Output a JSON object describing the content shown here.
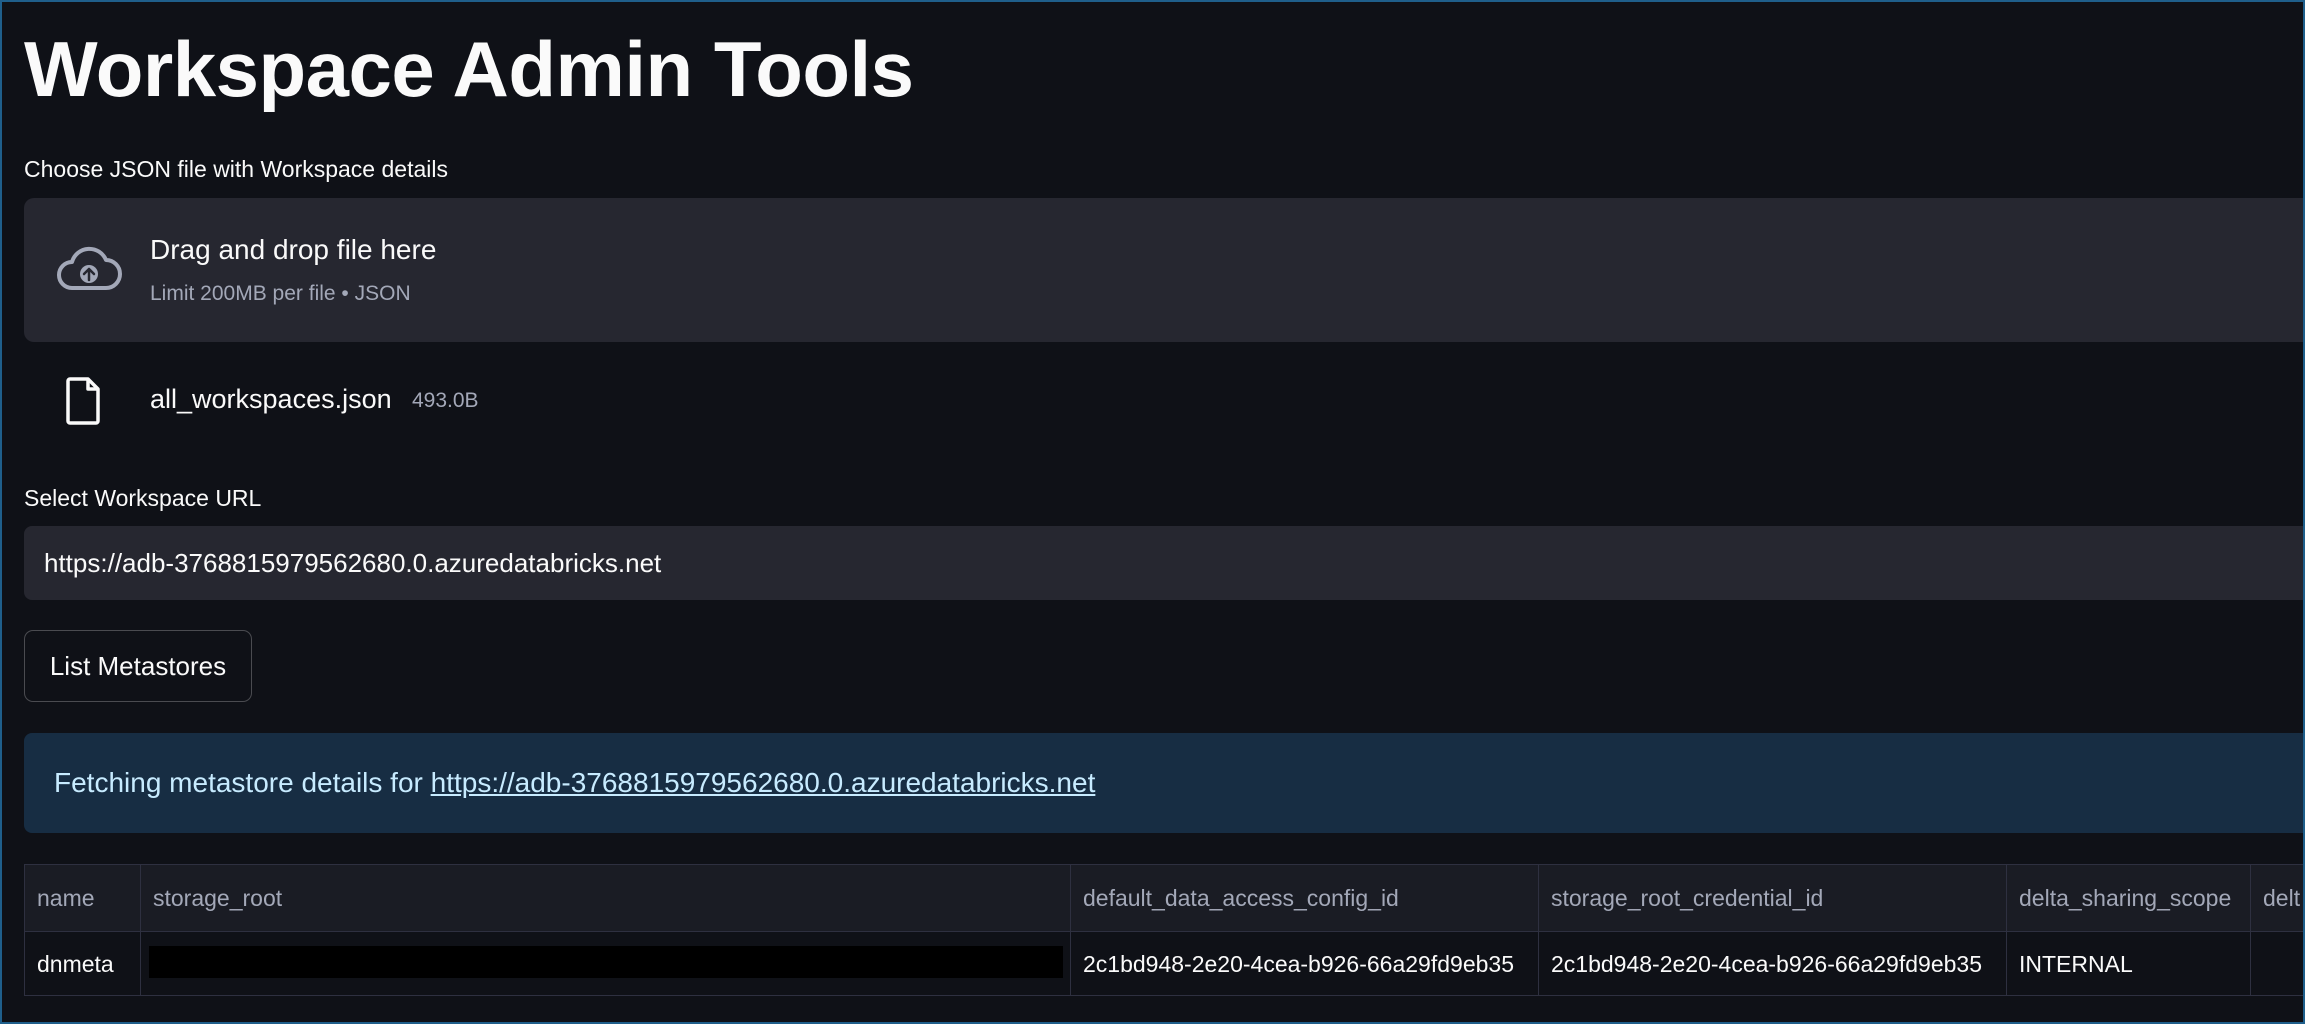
{
  "page": {
    "title": "Workspace Admin Tools"
  },
  "uploader": {
    "label": "Choose JSON file with Workspace details",
    "dropzone_text": "Drag and drop file here",
    "limit_text": "Limit 200MB per file • JSON",
    "upload_icon": "cloud-upload-icon",
    "file": {
      "icon": "file-icon",
      "name": "all_workspaces.json",
      "size": "493.0B"
    }
  },
  "workspace_select": {
    "label": "Select Workspace URL",
    "value": "https://adb-3768815979562680.0.azuredatabricks.net"
  },
  "actions": {
    "list_metastores_label": "List Metastores"
  },
  "info": {
    "prefix": "Fetching metastore details for ",
    "link": "https://adb-3768815979562680.0.azuredatabricks.net"
  },
  "table": {
    "columns": [
      "name",
      "storage_root",
      "default_data_access_config_id",
      "storage_root_credential_id",
      "delta_sharing_scope",
      "delt"
    ],
    "rows": [
      [
        "dnmeta",
        "",
        "2c1bd948-2e20-4cea-b926-66a29fd9eb35",
        "2c1bd948-2e20-4cea-b926-66a29fd9eb35",
        "INTERNAL",
        ""
      ]
    ]
  },
  "colors": {
    "background": "#0f1117",
    "panel": "#262730",
    "info_background": "#172d43",
    "info_text": "#c7ebff",
    "frame_border": "#1f5f8b"
  }
}
